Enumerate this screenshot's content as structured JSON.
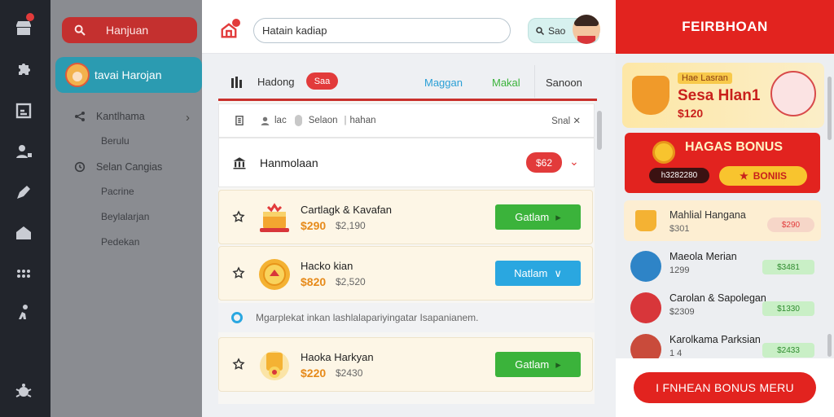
{
  "rail": {
    "badge": "!",
    "icons": [
      "store-icon",
      "puzzle-icon",
      "report-icon",
      "user-icon",
      "tag-icon",
      "house-icon",
      "grid-icon",
      "person-run-icon",
      "settings-bug-icon"
    ]
  },
  "sidebar": {
    "search_label": "Hanjuan",
    "active_label": "tavai Harojan",
    "items": [
      {
        "label": "Kantlhama"
      },
      {
        "label": "Berulu"
      },
      {
        "label": "Selan Cangias"
      },
      {
        "label": "Pacrine"
      },
      {
        "label": "Beylalarjan"
      },
      {
        "label": "Pedekan"
      }
    ]
  },
  "topbar": {
    "search_value": "Hatain kadiap",
    "chip_label": "Sao"
  },
  "tabs": {
    "lead_label": "Hadong",
    "pill": "Saa",
    "items": [
      {
        "label": "Maggan",
        "color": "#2a9fd6"
      },
      {
        "label": "Makal",
        "color": "#3bb33b"
      },
      {
        "label": "Sanoon",
        "color": "#333333"
      }
    ]
  },
  "filters": {
    "a": "lac",
    "b": "Selaon",
    "c": "hahan",
    "close_label": "Snal ✕"
  },
  "summary": {
    "title": "Hanmolaan",
    "price": "$62"
  },
  "cards": [
    {
      "title": "Cartlagk & Kavafan",
      "price": "$290",
      "old_price": "$2,190",
      "button": "Gatlam",
      "button_color": "#3bb33b",
      "button_glyph": "▸"
    },
    {
      "title": "Hacko kian",
      "price": "$820",
      "old_price": "$2,520",
      "button": "Natlam",
      "button_color": "#2aa7e0",
      "button_glyph": "∨"
    },
    {
      "title": "Haoka Harkyan",
      "price": "$220",
      "old_price": "$2430",
      "button": "Gatlam",
      "button_color": "#3bb33b",
      "button_glyph": "▸"
    }
  ],
  "note": "Mgarplekat inkan lashlalapariyingatar Isapanianem.",
  "right_panel": {
    "header": "FEIRBHOAN",
    "promo1": {
      "tag": "Hae Lasran",
      "title": "Sesa Hlan1",
      "amount": "$120"
    },
    "promo2": {
      "title": "HAGAS BONUS",
      "code": "h3282280",
      "bonus": "BONIIS"
    },
    "featured": {
      "title": "Mahlial Hangana",
      "sub": "$301",
      "chip": "$290"
    },
    "people": [
      {
        "name": "Maeola Merian",
        "value": "1299",
        "chip": "$3481",
        "avatar_color": "#2e84c7"
      },
      {
        "name": "Carolan & Sapolegan",
        "value": "$2309",
        "chip": "$1330",
        "avatar_color": "#d8363a"
      },
      {
        "name": "Karolkama Parksian",
        "value": "1 4",
        "chip": "$2433",
        "avatar_color": "#c94b3b"
      }
    ],
    "cta": "I FNHEAN BONUS MERU"
  }
}
